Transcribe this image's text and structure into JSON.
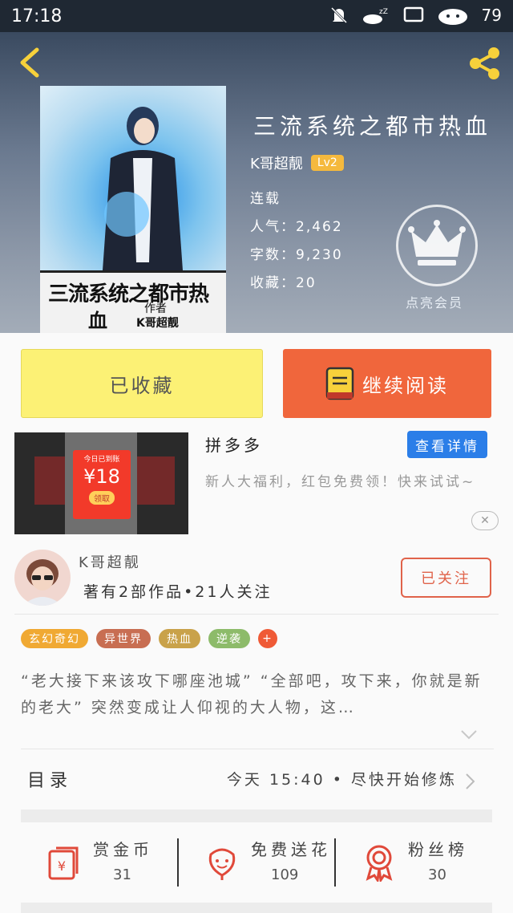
{
  "status_bar": {
    "time": "17:18",
    "battery": "79"
  },
  "book": {
    "title": "三流系统之都市热血",
    "author": "K哥超靓",
    "level": "Lv2",
    "status": "连载",
    "popularity_label": "人气：",
    "popularity": "2,462",
    "words_label": "字数：",
    "words": "9,230",
    "favorites_label": "收藏：",
    "favorites": "20",
    "cover": {
      "title_line1": "三流系统之都市热",
      "title_line2": "血",
      "author_tag": "作者",
      "author_name": "K哥超靓"
    }
  },
  "vip": {
    "label": "点亮会员"
  },
  "actions": {
    "favorite_label": "已收藏",
    "read_label": "继续阅读"
  },
  "ad": {
    "name": "拼多多",
    "button": "查看详情",
    "description": "新人大福利，红包免费领！快来试试~",
    "close": "✕",
    "image": {
      "small": "今日已到账",
      "amount": "¥18",
      "get": "领取"
    }
  },
  "author_card": {
    "name": "K哥超靓",
    "stats": "著有2部作品•21人关注",
    "follow_label": "已关注"
  },
  "tags": [
    {
      "label": "玄幻奇幻",
      "color": "#f0a933"
    },
    {
      "label": "异世界",
      "color": "#c86e52"
    },
    {
      "label": "热血",
      "color": "#c9a24a"
    },
    {
      "label": "逆袭",
      "color": "#8dbb6a"
    },
    {
      "label": "+",
      "color": "#ef5a36"
    }
  ],
  "synopsis": "“老大接下来该攻下哪座池城” “全部吧，攻下来，你就是新的老大” 突然变成让人仰视的大人物，这…",
  "toc": {
    "label": "目录",
    "latest": "今天 15:40 • 尽快开始修炼"
  },
  "stats": [
    {
      "label": "赏金币",
      "value": "31",
      "icon": "red-envelope-icon"
    },
    {
      "label": "免费送花",
      "value": "109",
      "icon": "flower-icon"
    },
    {
      "label": "粉丝榜",
      "value": "30",
      "icon": "medal-icon"
    }
  ]
}
